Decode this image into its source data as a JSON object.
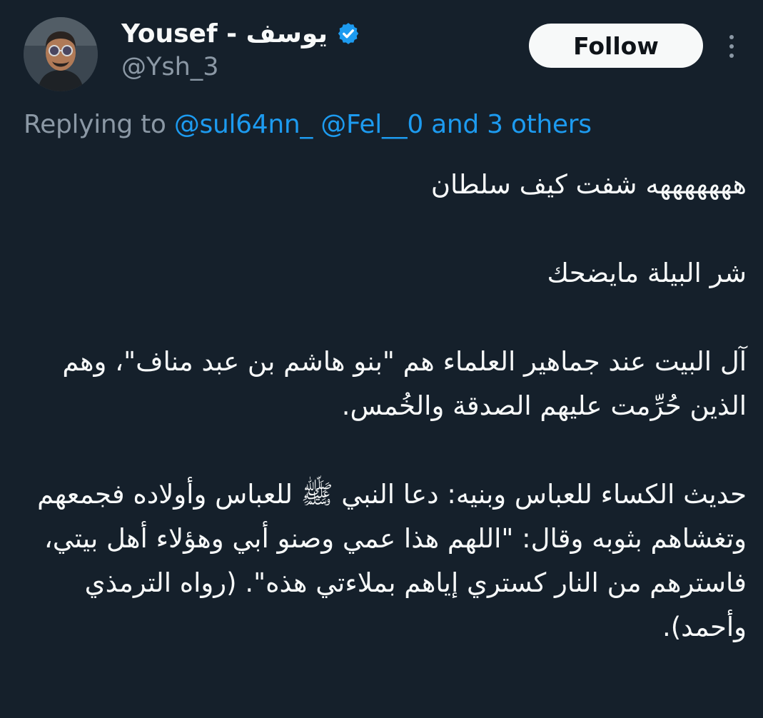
{
  "author": {
    "name": "Yousef - يوسف",
    "handle": "@Ysh_3",
    "verified": true
  },
  "actions": {
    "follow_label": "Follow",
    "more_icon": "more-vertical-icon"
  },
  "reply": {
    "prefix": "Replying to ",
    "mention_1": "@sul64nn_",
    "mention_2": "@Fel__0",
    "others": "and 3 others"
  },
  "body": {
    "line_1": "هههههههه شفت كيف سلطان",
    "line_2": "شر البيلة مايضحك",
    "paragraph_3": "آل البيت عند جماهير العلماء هم \"بنو هاشم بن عبد مناف\"، وهم الذين حُرِّمت عليهم الصدقة والخُمس.",
    "paragraph_4": "حديث الكساء للعباس وبنيه: دعا النبي ﷺ للعباس وأولاده فجمعهم وتغشاهم بثوبه وقال: \"اللهم هذا عمي وصنو أبي وهؤلاء أهل بيتي، فاسترهم من النار كستري إياهم بملاءتي هذه\". (رواه الترمذي وأحمد)."
  },
  "colors": {
    "background": "#15202b",
    "text": "#f7f9f9",
    "secondary": "#8b98a5",
    "accent": "#1d9bf0"
  }
}
